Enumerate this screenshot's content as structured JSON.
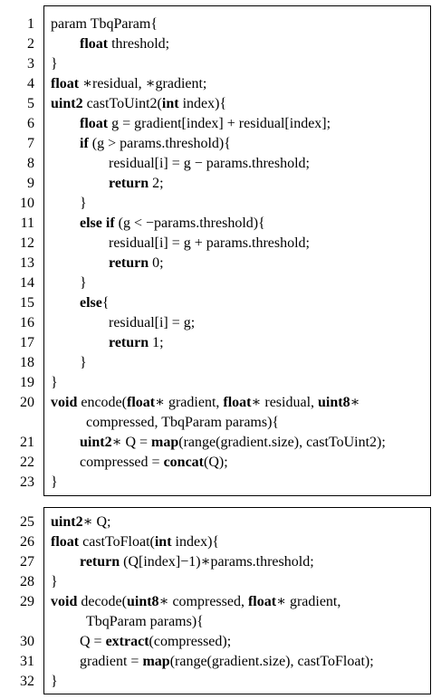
{
  "listing": {
    "lines": [
      {
        "num": "1",
        "segs": [
          [
            "param TbqParam{",
            0
          ]
        ]
      },
      {
        "num": "2",
        "segs": [
          [
            "float",
            1
          ],
          [
            " threshold;",
            0
          ]
        ]
      },
      {
        "num": "3",
        "segs": [
          [
            "}",
            0
          ]
        ]
      },
      {
        "num": "4",
        "segs": [
          [
            "float",
            1
          ],
          [
            " ∗residual, ∗gradient;",
            0
          ]
        ]
      },
      {
        "num": "5",
        "segs": [
          [
            "uint2",
            1
          ],
          [
            " castToUint2(",
            0
          ],
          [
            "int",
            1
          ],
          [
            " index){",
            0
          ]
        ]
      },
      {
        "num": "6",
        "segs": [
          [
            "float",
            1
          ],
          [
            " g = gradient[index] + residual[index];",
            0
          ]
        ]
      },
      {
        "num": "7",
        "segs": [
          [
            "if",
            1
          ],
          [
            " (g > params.threshold){",
            0
          ]
        ]
      },
      {
        "num": "8",
        "segs": [
          [
            "residual[i] = g − params.threshold;",
            0
          ]
        ]
      },
      {
        "num": "9",
        "segs": [
          [
            "return",
            1
          ],
          [
            " 2;",
            0
          ]
        ]
      },
      {
        "num": "10",
        "segs": [
          [
            "}",
            0
          ]
        ]
      },
      {
        "num": "11",
        "segs": [
          [
            "else if",
            1
          ],
          [
            " (g < −params.threshold){",
            0
          ]
        ]
      },
      {
        "num": "12",
        "segs": [
          [
            "residual[i] = g + params.threshold;",
            0
          ]
        ]
      },
      {
        "num": "13",
        "segs": [
          [
            "return",
            1
          ],
          [
            " 0;",
            0
          ]
        ]
      },
      {
        "num": "14",
        "segs": [
          [
            "}",
            0
          ]
        ]
      },
      {
        "num": "15",
        "segs": [
          [
            "else",
            1
          ],
          [
            "{",
            0
          ]
        ]
      },
      {
        "num": "16",
        "segs": [
          [
            "residual[i] = g;",
            0
          ]
        ]
      },
      {
        "num": "17",
        "segs": [
          [
            "return",
            1
          ],
          [
            " 1;",
            0
          ]
        ]
      },
      {
        "num": "18",
        "segs": [
          [
            "}",
            0
          ]
        ]
      },
      {
        "num": "19",
        "segs": [
          [
            "}",
            0
          ]
        ]
      },
      {
        "num": "20",
        "segs": [
          [
            "void",
            1
          ],
          [
            " encode(",
            0
          ],
          [
            "float",
            1
          ],
          [
            "∗ gradient, ",
            0
          ],
          [
            "float",
            1
          ],
          [
            "∗ residual, ",
            0
          ],
          [
            "uint8",
            1
          ],
          [
            "∗",
            0
          ]
        ]
      },
      {
        "num": "",
        "segs": [
          [
            "compressed, TbqParam params){",
            0
          ]
        ]
      },
      {
        "num": "21",
        "segs": [
          [
            "uint2",
            1
          ],
          [
            "∗ Q = ",
            0
          ],
          [
            "map",
            1
          ],
          [
            "(range(gradient.size), castToUint2);",
            0
          ]
        ]
      },
      {
        "num": "22",
        "segs": [
          [
            "compressed = ",
            0
          ],
          [
            "concat",
            1
          ],
          [
            "(Q);",
            0
          ]
        ]
      },
      {
        "num": "23",
        "segs": [
          [
            "}",
            0
          ]
        ]
      },
      {
        "num": "25",
        "segs": [
          [
            "uint2",
            1
          ],
          [
            "∗ Q;",
            0
          ]
        ]
      },
      {
        "num": "26",
        "segs": [
          [
            "float",
            1
          ],
          [
            " castToFloat(",
            0
          ],
          [
            "int",
            1
          ],
          [
            " index){",
            0
          ]
        ]
      },
      {
        "num": "27",
        "segs": [
          [
            "return",
            1
          ],
          [
            " (Q[index]−1)∗params.threshold;",
            0
          ]
        ]
      },
      {
        "num": "28",
        "segs": [
          [
            "}",
            0
          ]
        ]
      },
      {
        "num": "29",
        "segs": [
          [
            "void",
            1
          ],
          [
            " decode(",
            0
          ],
          [
            "uint8",
            1
          ],
          [
            "∗ compressed, ",
            0
          ],
          [
            "float",
            1
          ],
          [
            "∗ gradient,",
            0
          ]
        ]
      },
      {
        "num": "",
        "segs": [
          [
            "TbqParam params){",
            0
          ]
        ]
      },
      {
        "num": "30",
        "segs": [
          [
            "Q = ",
            0
          ],
          [
            "extract",
            1
          ],
          [
            "(compressed);",
            0
          ]
        ]
      },
      {
        "num": "31",
        "segs": [
          [
            "gradient = ",
            0
          ],
          [
            "map",
            1
          ],
          [
            "(range(gradient.size), castToFloat);",
            0
          ]
        ]
      },
      {
        "num": "32",
        "segs": [
          [
            "}",
            0
          ]
        ]
      }
    ]
  }
}
